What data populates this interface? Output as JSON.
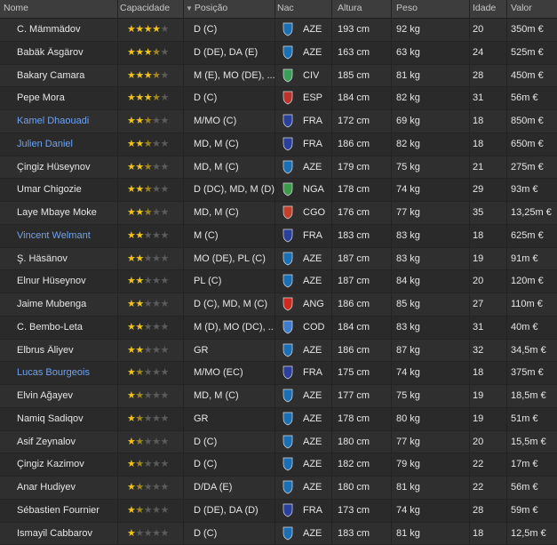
{
  "columns": {
    "name": "Nome",
    "ability": "Capacidade",
    "position": "Posição",
    "nationality": "Nac",
    "height": "Altura",
    "weight": "Peso",
    "age": "Idade",
    "value": "Valor"
  },
  "players": [
    {
      "name": "C. Mämmädov",
      "stars": 4,
      "position": "D (C)",
      "nat": "AZE",
      "flag": "aze-icon",
      "height": "193 cm",
      "weight": "92 kg",
      "age": "20",
      "value": "350m €",
      "loan": false
    },
    {
      "name": "Babäk Äsgärov",
      "stars": 3.5,
      "position": "D (DE), DA (E)",
      "nat": "AZE",
      "flag": "aze-icon",
      "height": "163 cm",
      "weight": "63 kg",
      "age": "24",
      "value": "525m €",
      "loan": false
    },
    {
      "name": "Bakary Camara",
      "stars": 3.5,
      "position": "M (E), MO (DE), ...",
      "nat": "CIV",
      "flag": "civ-icon",
      "height": "185 cm",
      "weight": "81 kg",
      "age": "28",
      "value": "450m €",
      "loan": false
    },
    {
      "name": "Pepe Mora",
      "stars": 3.5,
      "position": "D (C)",
      "nat": "ESP",
      "flag": "esp-icon",
      "height": "184 cm",
      "weight": "82 kg",
      "age": "31",
      "value": "56m €",
      "loan": false
    },
    {
      "name": "Kamel Dhaouadi",
      "stars": 2.5,
      "position": "M/MO (C)",
      "nat": "FRA",
      "flag": "fra-icon",
      "height": "172 cm",
      "weight": "69 kg",
      "age": "18",
      "value": "850m €",
      "loan": true
    },
    {
      "name": "Julien Daniel",
      "stars": 2.5,
      "position": "MD, M (C)",
      "nat": "FRA",
      "flag": "fra-icon",
      "height": "186 cm",
      "weight": "82 kg",
      "age": "18",
      "value": "650m €",
      "loan": true
    },
    {
      "name": "Çingiz Hüseynov",
      "stars": 2.5,
      "position": "MD, M (C)",
      "nat": "AZE",
      "flag": "aze-icon",
      "height": "179 cm",
      "weight": "75 kg",
      "age": "21",
      "value": "275m €",
      "loan": false
    },
    {
      "name": "Umar Chigozie",
      "stars": 2.5,
      "position": "D (DC), MD, M (D)",
      "nat": "NGA",
      "flag": "nga-icon",
      "height": "178 cm",
      "weight": "74 kg",
      "age": "29",
      "value": "93m €",
      "loan": false
    },
    {
      "name": "Laye Mbaye Moke",
      "stars": 2.5,
      "position": "MD, M (C)",
      "nat": "CGO",
      "flag": "cgo-icon",
      "height": "176 cm",
      "weight": "77 kg",
      "age": "35",
      "value": "13,25m €",
      "loan": false
    },
    {
      "name": "Vincent Welmant",
      "stars": 2,
      "position": "M (C)",
      "nat": "FRA",
      "flag": "fra-icon",
      "height": "183 cm",
      "weight": "83 kg",
      "age": "18",
      "value": "625m €",
      "loan": true
    },
    {
      "name": "Ş. Häsänov",
      "stars": 2,
      "position": "MO (DE), PL (C)",
      "nat": "AZE",
      "flag": "aze-icon",
      "height": "187 cm",
      "weight": "83 kg",
      "age": "19",
      "value": "91m €",
      "loan": false
    },
    {
      "name": "Elnur Hüseynov",
      "stars": 2,
      "position": "PL (C)",
      "nat": "AZE",
      "flag": "aze-icon",
      "height": "187 cm",
      "weight": "84 kg",
      "age": "20",
      "value": "120m €",
      "loan": false
    },
    {
      "name": "Jaime Mubenga",
      "stars": 2,
      "position": "D (C), MD, M (C)",
      "nat": "ANG",
      "flag": "ang-icon",
      "height": "186 cm",
      "weight": "85 kg",
      "age": "27",
      "value": "110m €",
      "loan": false
    },
    {
      "name": "C. Bembo-Leta",
      "stars": 2,
      "position": "M (D), MO (DC), ...",
      "nat": "COD",
      "flag": "cod-icon",
      "height": "184 cm",
      "weight": "83 kg",
      "age": "31",
      "value": "40m €",
      "loan": false
    },
    {
      "name": "Elbrus Äliyev",
      "stars": 2,
      "position": "GR",
      "nat": "AZE",
      "flag": "aze-icon",
      "height": "186 cm",
      "weight": "87 kg",
      "age": "32",
      "value": "34,5m €",
      "loan": false
    },
    {
      "name": "Lucas Bourgeois",
      "stars": 1.5,
      "position": "M/MO (EC)",
      "nat": "FRA",
      "flag": "fra-icon",
      "height": "175 cm",
      "weight": "74 kg",
      "age": "18",
      "value": "375m €",
      "loan": true
    },
    {
      "name": "Elvin Ağayev",
      "stars": 1.5,
      "position": "MD, M (C)",
      "nat": "AZE",
      "flag": "aze-icon",
      "height": "177 cm",
      "weight": "75 kg",
      "age": "19",
      "value": "18,5m €",
      "loan": false
    },
    {
      "name": "Namiq Sadiqov",
      "stars": 1.5,
      "position": "GR",
      "nat": "AZE",
      "flag": "aze-icon",
      "height": "178 cm",
      "weight": "80 kg",
      "age": "19",
      "value": "51m €",
      "loan": false
    },
    {
      "name": "Asif Zeynalov",
      "stars": 1.5,
      "position": "D (C)",
      "nat": "AZE",
      "flag": "aze-icon",
      "height": "180 cm",
      "weight": "77 kg",
      "age": "20",
      "value": "15,5m €",
      "loan": false
    },
    {
      "name": "Çingiz Kazimov",
      "stars": 1.5,
      "position": "D (C)",
      "nat": "AZE",
      "flag": "aze-icon",
      "height": "182 cm",
      "weight": "79 kg",
      "age": "22",
      "value": "17m €",
      "loan": false
    },
    {
      "name": "Anar Hudiyev",
      "stars": 1.5,
      "position": "D/DA (E)",
      "nat": "AZE",
      "flag": "aze-icon",
      "height": "180 cm",
      "weight": "81 kg",
      "age": "22",
      "value": "56m €",
      "loan": false
    },
    {
      "name": "Sébastien Fournier",
      "stars": 1.5,
      "position": "D (DE), DA (D)",
      "nat": "FRA",
      "flag": "fra-icon",
      "height": "173 cm",
      "weight": "74 kg",
      "age": "28",
      "value": "59m €",
      "loan": false
    },
    {
      "name": "Ismayil Cabbarov",
      "stars": 1,
      "position": "D (C)",
      "nat": "AZE",
      "flag": "aze-icon",
      "height": "183 cm",
      "weight": "81 kg",
      "age": "18",
      "value": "12,5m €",
      "loan": false
    }
  ],
  "colors": {
    "star": "#f0c419",
    "loan_name": "#6fa3ee",
    "aze": "#1a6fb5",
    "fra": "#2b3f9c",
    "civ": "#3b9d5a",
    "esp": "#b8342c",
    "nga": "#3c9a4a",
    "cgo": "#c2402c",
    "ang": "#cf2a1f",
    "cod": "#3d7dcf"
  }
}
